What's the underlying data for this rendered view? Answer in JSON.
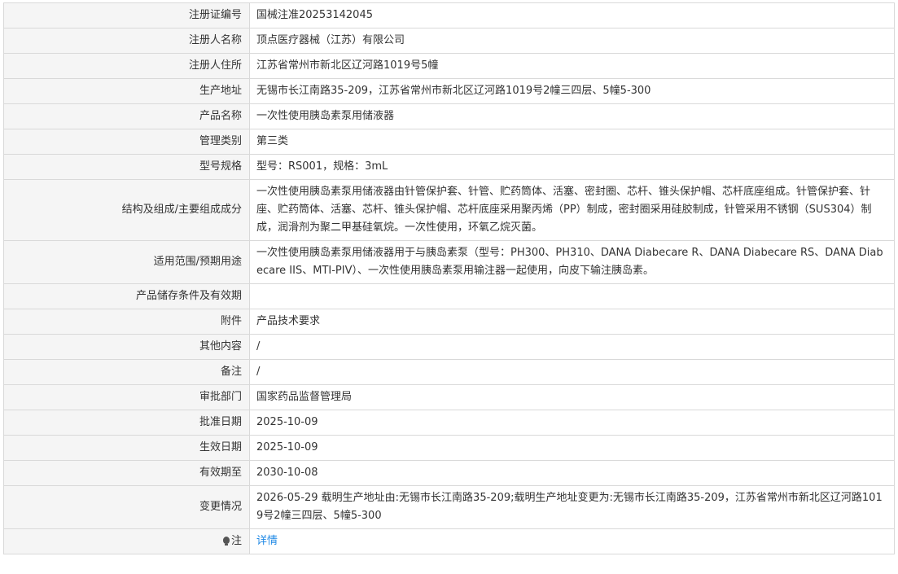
{
  "rows": [
    {
      "label": "注册证编号",
      "value": "国械注准20253142045"
    },
    {
      "label": "注册人名称",
      "value": "顶点医疗器械（江苏）有限公司"
    },
    {
      "label": "注册人住所",
      "value": "江苏省常州市新北区辽河路1019号5幢"
    },
    {
      "label": "生产地址",
      "value": "无锡市长江南路35-209，江苏省常州市新北区辽河路1019号2幢三四层、5幢5-300"
    },
    {
      "label": "产品名称",
      "value": "一次性使用胰岛素泵用储液器"
    },
    {
      "label": "管理类别",
      "value": "第三类"
    },
    {
      "label": "型号规格",
      "value": "型号：RS001，规格：3mL"
    },
    {
      "label": "结构及组成/主要组成成分",
      "value": "一次性使用胰岛素泵用储液器由针管保护套、针管、贮药筒体、活塞、密封圈、芯杆、锥头保护帽、芯杆底座组成。针管保护套、针座、贮药筒体、活塞、芯杆、锥头保护帽、芯杆底座采用聚丙烯（PP）制成，密封圈采用硅胶制成，针管采用不锈钢（SUS304）制成，润滑剂为聚二甲基硅氧烷。一次性使用，环氧乙烷灭菌。"
    },
    {
      "label": "适用范围/预期用途",
      "value": "一次性使用胰岛素泵用储液器用于与胰岛素泵（型号：PH300、PH310、DANA Diabecare R、DANA Diabecare RS、DANA Diabecare IIS、MTI-PIV）、一次性使用胰岛素泵用输注器一起使用，向皮下输注胰岛素。"
    },
    {
      "label": "产品储存条件及有效期",
      "value": ""
    },
    {
      "label": "附件",
      "value": "产品技术要求"
    },
    {
      "label": "其他内容",
      "value": "/"
    },
    {
      "label": "备注",
      "value": "/"
    },
    {
      "label": "审批部门",
      "value": "国家药品监督管理局"
    },
    {
      "label": "批准日期",
      "value": "2025-10-09"
    },
    {
      "label": "生效日期",
      "value": "2025-10-09"
    },
    {
      "label": "有效期至",
      "value": "2030-10-08"
    },
    {
      "label": "变更情况",
      "value": "2026-05-29 载明生产地址由:无锡市长江南路35-209;载明生产地址变更为:无锡市长江南路35-209，江苏省常州市新北区辽河路1019号2幢三四层、5幢5-300"
    }
  ],
  "note": {
    "label": "注",
    "icon": "bulb-icon",
    "link_text": "详情"
  }
}
